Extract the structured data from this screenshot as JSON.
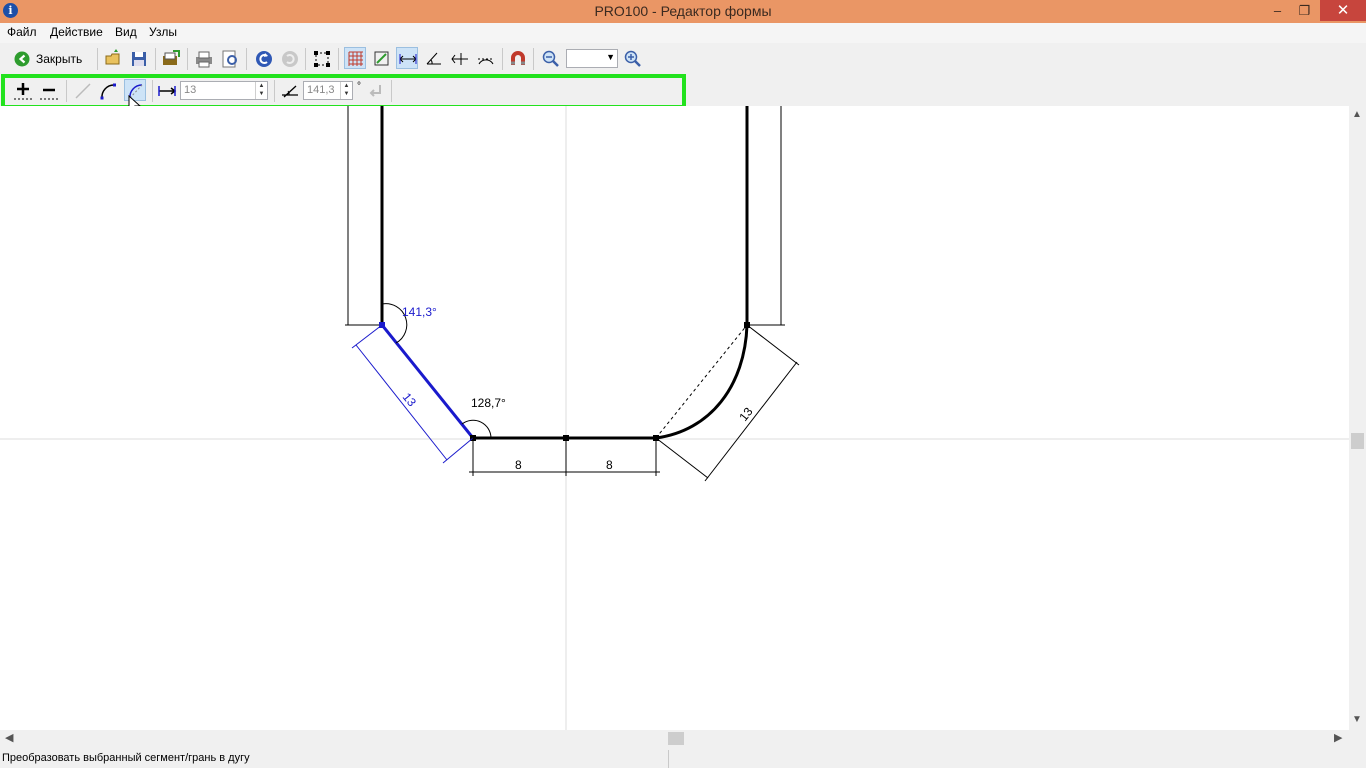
{
  "window": {
    "title": "PRO100 - Редактор формы",
    "app_icon_glyph": "i",
    "minimize_glyph": "–",
    "maximize_glyph": "❐",
    "close_glyph": "✕"
  },
  "menu": {
    "items": [
      {
        "label": "Файл"
      },
      {
        "label": "Действие"
      },
      {
        "label": "Вид"
      },
      {
        "label": "Узлы"
      }
    ]
  },
  "toolbar": {
    "close_label": "Закрыть",
    "zoom_value": "",
    "buttons": [
      "open-icon",
      "save-icon",
      "export-icon",
      "print-icon",
      "print-preview-icon",
      "undo-icon",
      "redo-icon",
      "select-nodes-icon",
      "grid-icon",
      "snap-grid-icon",
      "dimension-icon",
      "angle-icon",
      "angle-dimension-icon",
      "arc-dimension-icon",
      "magnet-icon",
      "zoom-out-icon",
      "zoom-in-icon"
    ]
  },
  "nodes_toolbar": {
    "length_value": "13",
    "angle_value": "141,3",
    "angle_unit": "°",
    "buttons": [
      "add-node-icon",
      "remove-node-icon",
      "line-segment-icon",
      "arc-segment-icon",
      "convert-to-arc-icon",
      "length-icon",
      "angle-icon",
      "apply-icon"
    ]
  },
  "drawing": {
    "angle_selected": "141,3°",
    "angle_other": "128,7°",
    "selected_segment_length": "13",
    "arc_chord_length": "13",
    "bottom_left_length": "8",
    "bottom_right_length": "8",
    "colors": {
      "selected": "#1a1acc",
      "outline": "#000000",
      "guide": "#d8d8d8"
    }
  },
  "status": {
    "text": "Преобразовать выбранный сегмент/грань в дугу"
  }
}
